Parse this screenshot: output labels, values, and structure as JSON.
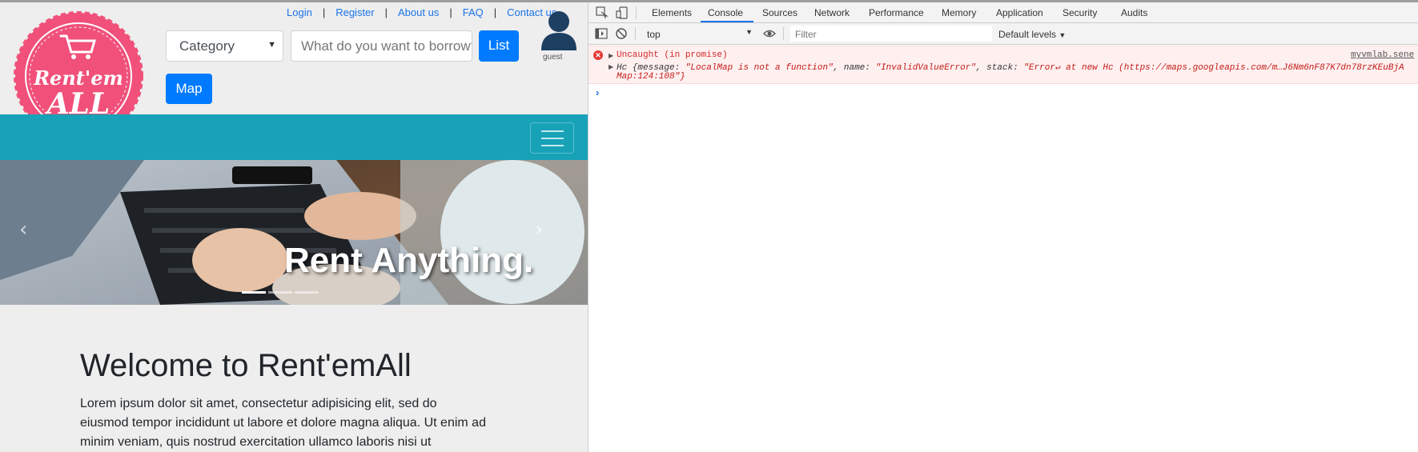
{
  "site": {
    "logo": {
      "line1": "Rent'em",
      "line2": "ALL"
    },
    "top_links": [
      "Login",
      "Register",
      "About us",
      "FAQ",
      "Contact us"
    ],
    "category_select": {
      "value": "Category"
    },
    "search": {
      "placeholder": "What do you want to borrow?"
    },
    "list_button": "List",
    "map_button": "Map",
    "user": {
      "label": "guest"
    },
    "hero": {
      "caption": "Rent Anything.",
      "prev_icon": "‹",
      "next_icon": "›"
    },
    "welcome": {
      "heading": "Welcome to Rent'emAll",
      "paragraph": "Lorem ipsum dolor sit amet, consectetur adipisicing elit, sed do eiusmod tempor incididunt ut labore et dolore magna aliqua. Ut enim ad minim veniam, quis nostrud exercitation ullamco laboris nisi ut"
    },
    "colors": {
      "navbar": "#17a2b8",
      "primary_button": "#007bff",
      "logo_pink": "#f0507a"
    }
  },
  "devtools": {
    "tabs": [
      "Elements",
      "Console",
      "Sources",
      "Network",
      "Performance",
      "Memory",
      "Application",
      "Security",
      "Audits"
    ],
    "active_tab": "Console",
    "context": "top",
    "filter_placeholder": "Filter",
    "levels": "Default levels",
    "error": {
      "title": "Uncaught (in promise)",
      "source": "myvmlab.sene",
      "detail_prefix": "Hc {message: ",
      "message": "\"LocalMap is not a function\"",
      "name_part": ", name: ",
      "name": "\"InvalidValueError\"",
      "stack_part": ", stack: ",
      "stack": "\"Error↵    at new Hc (https://maps.googleapis.com/m…J6Nm6nF87K7dn78rzKEuBjA",
      "stack_end": "Map:124:108\"}"
    },
    "prompt_icon": "›"
  }
}
